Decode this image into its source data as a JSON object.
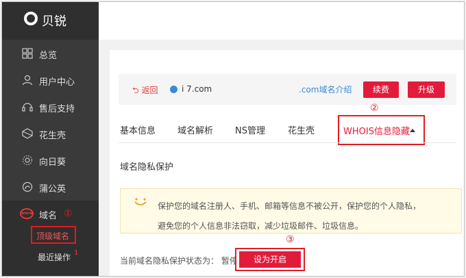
{
  "colors": {
    "sidebar_bg": "#3a3a3a",
    "accent_red": "#e31b3b",
    "link_blue": "#3a8ad8",
    "notice_bg": "#fffbe6"
  },
  "brand": {
    "logo_text": "贝锐"
  },
  "sidebar": {
    "items": [
      {
        "icon": "grid-icon",
        "label": "总览"
      },
      {
        "icon": "user-icon",
        "label": "用户中心"
      },
      {
        "icon": "headset-icon",
        "label": "售后支持"
      },
      {
        "icon": "peanut-shell-icon",
        "label": "花生壳"
      },
      {
        "icon": "sunflower-icon",
        "label": "向日葵"
      },
      {
        "icon": "dandelion-icon",
        "label": "蒲公英"
      },
      {
        "icon": "www-icon",
        "label": "域名"
      }
    ],
    "sub_items": [
      {
        "label": "顶级域名"
      },
      {
        "label": "最近操作"
      }
    ],
    "recent_badge": "1"
  },
  "domain_bar": {
    "back_label": "返回",
    "domain": "i    7.com",
    "intro_link": ".com域名介绍",
    "renew_label": "续费",
    "upgrade_label": "升级"
  },
  "tabs": [
    "基本信息",
    "域名解析",
    "NS管理",
    "花生壳",
    "WHOIS信息隐藏"
  ],
  "annotations": {
    "step1": "①",
    "step2": "②",
    "step3": "③"
  },
  "privacy": {
    "section_title": "域名隐私保护",
    "notice_line1": "保护您的域名注册人、手机、邮箱等信息不被公开，保护您的个人隐私，",
    "notice_line2": "避免您的个人信息非法窃取，减少垃圾邮件、垃圾信息。",
    "status_label": "当前域名隐私保护状态为：",
    "status_value": "暂停",
    "enable_label": "设为开启"
  }
}
